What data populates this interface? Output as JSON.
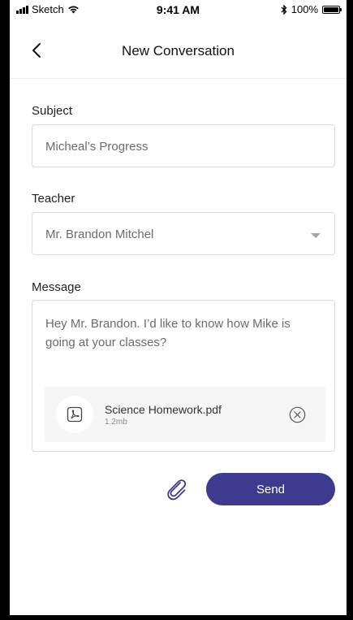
{
  "status_bar": {
    "carrier": "Sketch",
    "time": "9:41 AM",
    "battery": "100%"
  },
  "header": {
    "title": "New Conversation",
    "back_icon": "chevron-left-icon"
  },
  "form": {
    "subject_label": "Subject",
    "subject_value": "Micheal’s Progress",
    "teacher_label": "Teacher",
    "teacher_value": "Mr. Brandon Mitchel",
    "message_label": "Message",
    "message_value": "Hey Mr. Brandon. I’d like to know how Mike is going at your classes?",
    "attachment": {
      "name": "Science Homework.pdf",
      "size": "1.2mb",
      "icon": "pdf-file-icon",
      "remove_icon": "close-circle-icon"
    }
  },
  "actions": {
    "attach_icon": "paperclip-icon",
    "send_label": "Send"
  },
  "colors": {
    "primary": "#3d3a8f",
    "field_border": "#dcdcdc",
    "placeholder_text": "#6b6b6b",
    "attachment_bg": "#f6f6f6"
  }
}
